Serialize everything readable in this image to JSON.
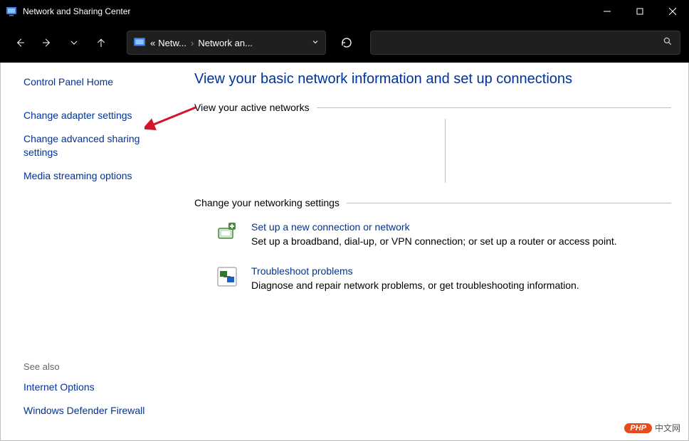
{
  "titlebar": {
    "title": "Network and Sharing Center"
  },
  "breadcrumb": {
    "seg1": "Netw...",
    "seg2": "Network an..."
  },
  "sidebar": {
    "home": "Control Panel Home",
    "link1": "Change adapter settings",
    "link2": "Change advanced sharing settings",
    "link3": "Media streaming options",
    "seealso_head": "See also",
    "seealso1": "Internet Options",
    "seealso2": "Windows Defender Firewall"
  },
  "main": {
    "heading": "View your basic network information and set up connections",
    "section_active": "View your active networks",
    "section_change": "Change your networking settings",
    "opt1_title": "Set up a new connection or network",
    "opt1_desc": "Set up a broadband, dial-up, or VPN connection; or set up a router or access point.",
    "opt2_title": "Troubleshoot problems",
    "opt2_desc": "Diagnose and repair network problems, or get troubleshooting information."
  },
  "watermark": {
    "badge": "PHP",
    "text": "中文网"
  }
}
